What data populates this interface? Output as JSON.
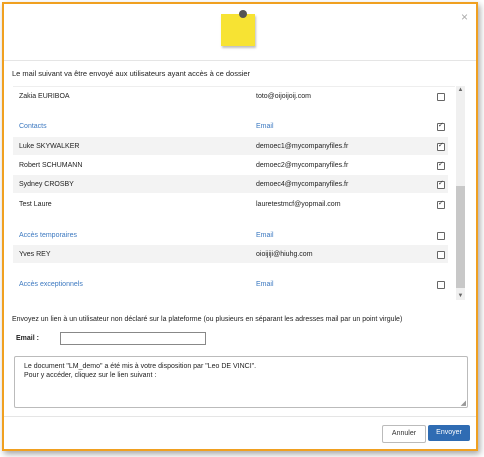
{
  "dialog": {
    "intro": "Le mail suivant va être envoyé aux utilisateurs ayant accès à ce dossier",
    "close": "×"
  },
  "list": {
    "rows": [
      {
        "kind": "user",
        "name": "Zakia EURIBOA",
        "email": "toto@oijoijoij.com",
        "checked": false
      },
      {
        "kind": "head",
        "name": "Contacts",
        "email": "Email",
        "checked": true
      },
      {
        "kind": "user",
        "name": "Luke SKYWALKER",
        "email": "demoec1@mycompanyfiles.fr",
        "checked": true
      },
      {
        "kind": "user",
        "name": "Robert SCHUMANN",
        "email": "demoec2@mycompanyfiles.fr",
        "checked": true
      },
      {
        "kind": "user",
        "name": "Sydney CROSBY",
        "email": "demoec4@mycompanyfiles.fr",
        "checked": true
      },
      {
        "kind": "user",
        "name": "Test Laure",
        "email": "lauretestmcf@yopmail.com",
        "checked": true
      },
      {
        "kind": "head",
        "name": "Accès temporaires",
        "email": "Email",
        "checked": false
      },
      {
        "kind": "user",
        "name": "Yves REY",
        "email": "oioijiji@hiuhg.com",
        "checked": false
      },
      {
        "kind": "head",
        "name": "Accès exceptionnels",
        "email": "Email",
        "checked": false
      }
    ]
  },
  "external": {
    "description": "Envoyez un lien à un utilisateur non déclaré sur la plateforme (ou plusieurs en séparant les adresses mail par un point virgule)",
    "email_label": "Email :",
    "email_value": ""
  },
  "message": {
    "line1": "Le document \"LM_demo\" a été mis à votre disposition par \"Leo DE VINCI\".",
    "line2": "Pour y accéder, cliquez sur le lien suivant :"
  },
  "buttons": {
    "cancel": "Annuler",
    "send": "Envoyer"
  },
  "colors": {
    "frame": "#f0a020",
    "accent": "#2f6cb3",
    "section_header": "#3b78c0",
    "note": "#f7e333"
  },
  "icons": {
    "note": "sticky-note-icon",
    "close": "close-icon"
  }
}
